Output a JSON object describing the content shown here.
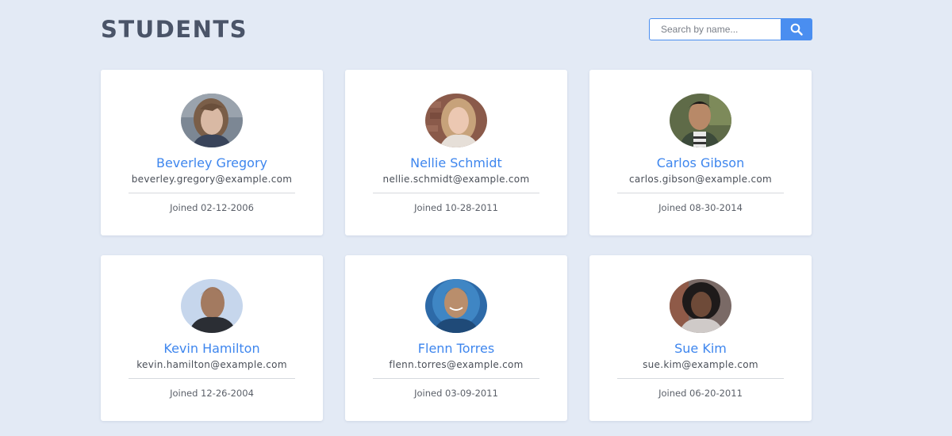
{
  "header": {
    "title": "STUDENTS"
  },
  "search": {
    "placeholder": "Search by name...",
    "icon": "search-icon"
  },
  "colors": {
    "accent": "#4a8ef0",
    "name": "#3e86ee",
    "background": "#e3eaf5"
  },
  "students": [
    {
      "name": "Beverley Gregory",
      "email": "beverley.gregory@example.com",
      "joined": "Joined 02-12-2006"
    },
    {
      "name": "Nellie Schmidt",
      "email": "nellie.schmidt@example.com",
      "joined": "Joined 10-28-2011"
    },
    {
      "name": "Carlos Gibson",
      "email": "carlos.gibson@example.com",
      "joined": "Joined 08-30-2014"
    },
    {
      "name": "Kevin Hamilton",
      "email": "kevin.hamilton@example.com",
      "joined": "Joined 12-26-2004"
    },
    {
      "name": "Flenn Torres",
      "email": "flenn.torres@example.com",
      "joined": "Joined 03-09-2011"
    },
    {
      "name": "Sue Kim",
      "email": "sue.kim@example.com",
      "joined": "Joined 06-20-2011"
    }
  ]
}
